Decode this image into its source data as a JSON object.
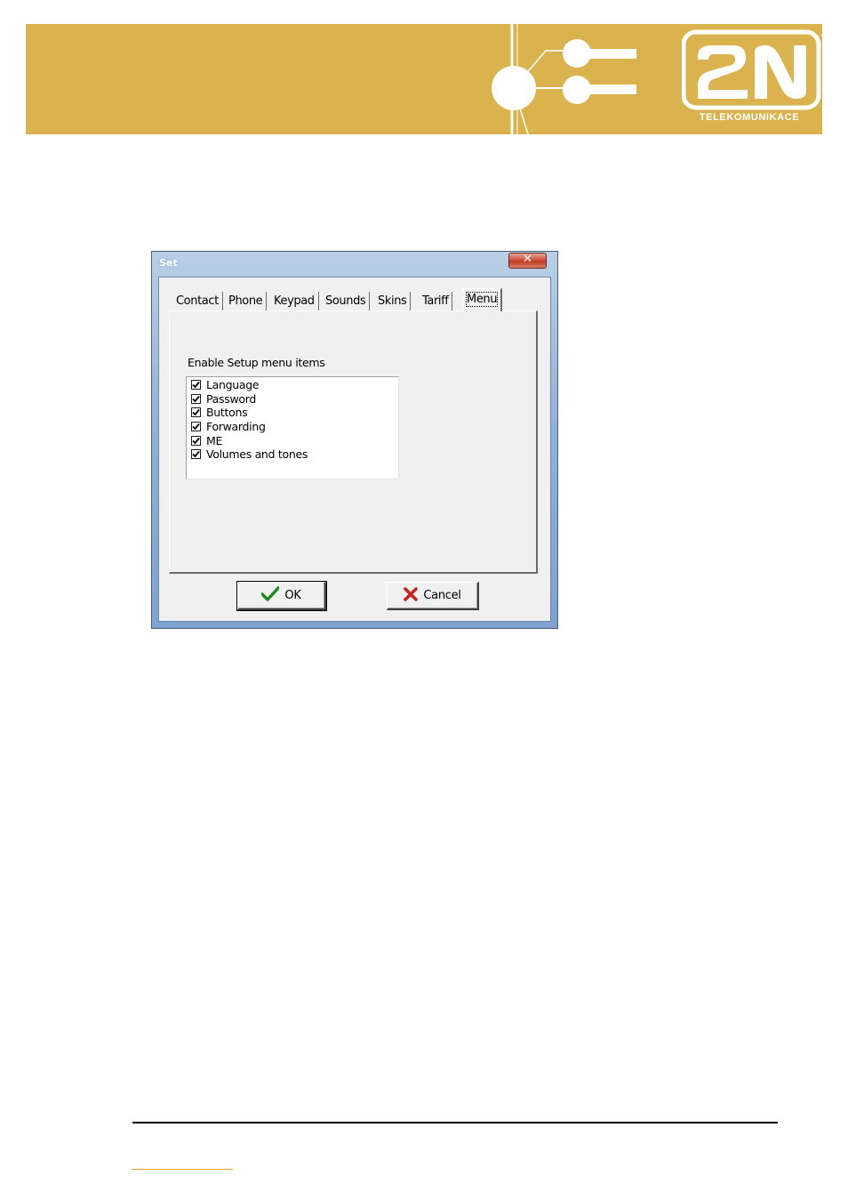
{
  "header": {
    "logo_mark": "2N",
    "logo_subtext": "TELEKOMUNIKACE",
    "colors": {
      "banner": "#dab24e",
      "logo": "#ffffff"
    }
  },
  "dialog": {
    "title": "Set",
    "close_icon": "close-icon",
    "tabs": [
      {
        "label": "Contact",
        "active": false
      },
      {
        "label": "Phone",
        "active": false
      },
      {
        "label": "Keypad",
        "active": false
      },
      {
        "label": "Sounds",
        "active": false
      },
      {
        "label": "Skins",
        "active": false
      },
      {
        "label": "Tariff",
        "active": false
      },
      {
        "label": "Menu",
        "active": true
      }
    ],
    "group_label": "Enable Setup menu items",
    "items": [
      {
        "label": "Language",
        "checked": true
      },
      {
        "label": "Password",
        "checked": true
      },
      {
        "label": "Buttons",
        "checked": true
      },
      {
        "label": "Forwarding",
        "checked": true
      },
      {
        "label": "ME",
        "checked": true
      },
      {
        "label": "Volumes and tones",
        "checked": true
      }
    ],
    "ok_label": "OK",
    "cancel_label": "Cancel",
    "icons": {
      "ok": "checkmark-icon",
      "cancel": "cross-icon"
    }
  }
}
